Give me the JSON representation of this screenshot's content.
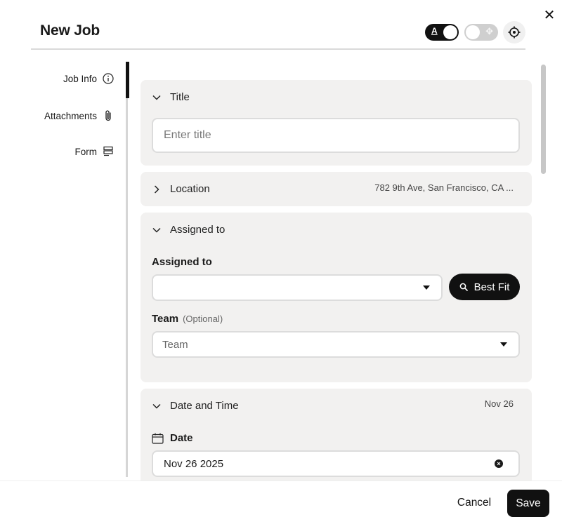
{
  "dialog": {
    "title": "New Job",
    "close_label": "✕",
    "text_toggle_glyph": "A",
    "move_toggle_glyph": "✥"
  },
  "sidebar": {
    "items": [
      {
        "label": "Job Info",
        "icon": "info-icon",
        "active": true
      },
      {
        "label": "Attachments",
        "icon": "paperclip-icon",
        "active": false
      },
      {
        "label": "Form",
        "icon": "form-icon",
        "active": false
      }
    ]
  },
  "sections": {
    "title": {
      "header": "Title",
      "expanded": true,
      "input_placeholder": "Enter title"
    },
    "location": {
      "header": "Location",
      "expanded": false,
      "summary": "782 9th Ave, San Francisco, CA ..."
    },
    "assigned": {
      "header": "Assigned to",
      "expanded": true,
      "assigned_label": "Assigned to",
      "assigned_value": "",
      "best_fit_label": "Best Fit",
      "team_label": "Team",
      "team_optional": "(Optional)",
      "team_placeholder": "Team"
    },
    "datetime": {
      "header": "Date and Time",
      "expanded": true,
      "summary": "Nov 26",
      "date_label": "Date",
      "date_value": "Nov 26 2025",
      "clear_glyph": "×"
    }
  },
  "footer": {
    "cancel_label": "Cancel",
    "save_label": "Save"
  },
  "colors": {
    "primary": "#111111",
    "section_bg": "#f2f1f0",
    "border": "#dcdcdc"
  }
}
